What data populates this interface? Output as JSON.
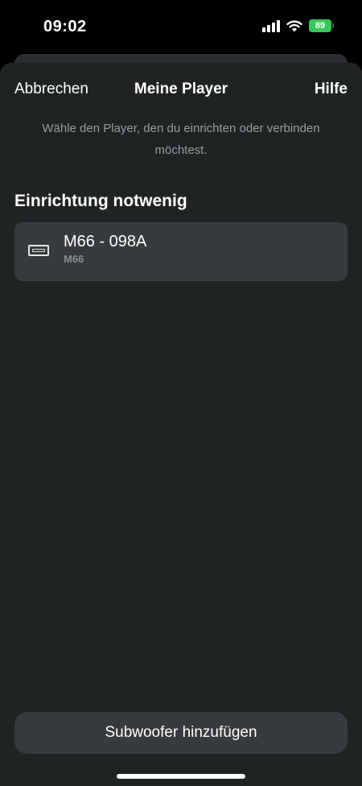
{
  "status_bar": {
    "time": "09:02",
    "battery_level": "89",
    "battery_color": "#35c759",
    "icons": [
      "signal-icon",
      "wifi-icon",
      "battery-icon"
    ]
  },
  "nav": {
    "cancel_label": "Abbrechen",
    "title": "Meine Player",
    "help_label": "Hilfe"
  },
  "subtitle": "Wähle den Player, den du einrichten oder verbinden möchtest.",
  "section": {
    "heading": "Einrichtung notwenig",
    "players": [
      {
        "name": "M66 - 098A",
        "model": "M66",
        "icon": "speaker-icon"
      }
    ]
  },
  "bottom_button": {
    "label": "Subwoofer hinzufügen"
  },
  "colors": {
    "sheet_background": "#202324",
    "card_background": "#383b3d",
    "secondary_text": "#9a9d9f"
  }
}
